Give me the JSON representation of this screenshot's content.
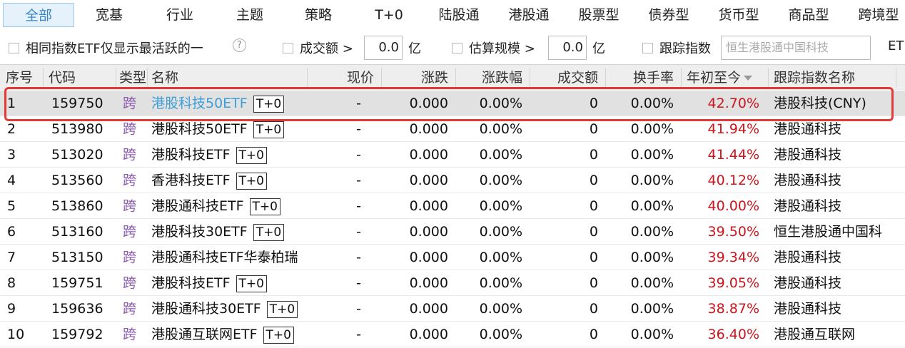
{
  "tabs": [
    {
      "label": "全部",
      "active": true
    },
    {
      "label": "宽基"
    },
    {
      "label": "行业"
    },
    {
      "label": "主题"
    },
    {
      "label": "策略"
    },
    {
      "label": "T+0"
    },
    {
      "label": "陆股通"
    },
    {
      "label": "港股通"
    },
    {
      "label": "股票型"
    },
    {
      "label": "债券型"
    },
    {
      "label": "货币型"
    },
    {
      "label": "商品型"
    },
    {
      "label": "跨境型"
    }
  ],
  "filters": {
    "same_index_label": "相同指数ETF仅显示最活跃的一",
    "help_glyph": "?",
    "turnover_label": "成交额 >",
    "turnover_value": "0.0",
    "turnover_unit": "亿",
    "scale_label": "估算规模 >",
    "scale_value": "0.0",
    "scale_unit": "亿",
    "track_label": "跟踪指数",
    "track_placeholder": "恒生港股通中国科技",
    "trailing_text": "ET"
  },
  "columns": {
    "seq": "序号",
    "code": "代码",
    "type": "类型",
    "name": "名称",
    "price": "现价",
    "change": "涨跌",
    "change_pct": "涨跌幅",
    "turnover": "成交额",
    "turnover_rate": "换手率",
    "ytd": "年初至今",
    "index_name": "跟踪指数名称"
  },
  "rows": [
    {
      "seq": "1",
      "code": "159750",
      "type": "跨",
      "name": "港股科技50ETF",
      "tag": "T+0",
      "price": "-",
      "change": "0.000",
      "change_pct": "0.00%",
      "turnover": "0",
      "turnover_rate": "0.00%",
      "ytd": "42.70%",
      "index_name": "港股科技(CNY)",
      "selected": true
    },
    {
      "seq": "2",
      "code": "513980",
      "type": "跨",
      "name": "港股科技50ETF",
      "tag": "T+0",
      "price": "-",
      "change": "0.000",
      "change_pct": "0.00%",
      "turnover": "0",
      "turnover_rate": "0.00%",
      "ytd": "41.94%",
      "index_name": "港股通科技"
    },
    {
      "seq": "3",
      "code": "513020",
      "type": "跨",
      "name": "港股科技ETF",
      "tag": "T+0",
      "price": "-",
      "change": "0.000",
      "change_pct": "0.00%",
      "turnover": "0",
      "turnover_rate": "0.00%",
      "ytd": "41.44%",
      "index_name": "港股通科技"
    },
    {
      "seq": "4",
      "code": "513560",
      "type": "跨",
      "name": "香港科技ETF",
      "tag": "T+0",
      "price": "-",
      "change": "0.000",
      "change_pct": "0.00%",
      "turnover": "0",
      "turnover_rate": "0.00%",
      "ytd": "40.12%",
      "index_name": "港股通科技"
    },
    {
      "seq": "5",
      "code": "513860",
      "type": "跨",
      "name": "港股通科技ETF",
      "tag": "T+0",
      "price": "-",
      "change": "0.000",
      "change_pct": "0.00%",
      "turnover": "0",
      "turnover_rate": "0.00%",
      "ytd": "40.00%",
      "index_name": "港股通科技"
    },
    {
      "seq": "6",
      "code": "513160",
      "type": "跨",
      "name": "港股科技30ETF",
      "tag": "T+0",
      "price": "-",
      "change": "0.000",
      "change_pct": "0.00%",
      "turnover": "0",
      "turnover_rate": "0.00%",
      "ytd": "39.50%",
      "index_name": "恒生港股通中国科"
    },
    {
      "seq": "7",
      "code": "513150",
      "type": "跨",
      "name": "港股通科技ETF华泰柏瑞",
      "tag": "",
      "price": "-",
      "change": "0.000",
      "change_pct": "0.00%",
      "turnover": "0",
      "turnover_rate": "0.00%",
      "ytd": "39.34%",
      "index_name": "港股通科技"
    },
    {
      "seq": "8",
      "code": "159751",
      "type": "跨",
      "name": "港股科技ETF",
      "tag": "T+0",
      "price": "-",
      "change": "0.000",
      "change_pct": "0.00%",
      "turnover": "0",
      "turnover_rate": "0.00%",
      "ytd": "39.05%",
      "index_name": "港股通科技"
    },
    {
      "seq": "9",
      "code": "159636",
      "type": "跨",
      "name": "港股通科技30ETF",
      "tag": "T+0",
      "price": "-",
      "change": "0.000",
      "change_pct": "0.00%",
      "turnover": "0",
      "turnover_rate": "0.00%",
      "ytd": "38.87%",
      "index_name": "港股通科技"
    },
    {
      "seq": "10",
      "code": "159792",
      "type": "跨",
      "name": "港股通互联网ETF",
      "tag": "T+0",
      "price": "-",
      "change": "0.000",
      "change_pct": "0.00%",
      "turnover": "0",
      "turnover_rate": "0.00%",
      "ytd": "36.40%",
      "index_name": "港股通互联网"
    }
  ],
  "colors": {
    "accent": "#3a86c8",
    "positive": "#d0141b",
    "cross_type": "#8a58b0",
    "highlight_box": "#e53935"
  }
}
